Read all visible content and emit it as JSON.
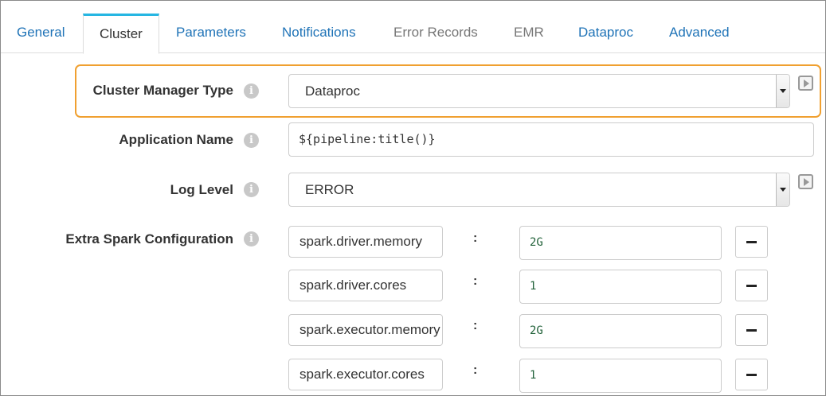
{
  "tabs": [
    {
      "label": "General",
      "state": "link"
    },
    {
      "label": "Cluster",
      "state": "active"
    },
    {
      "label": "Parameters",
      "state": "link"
    },
    {
      "label": "Notifications",
      "state": "link"
    },
    {
      "label": "Error Records",
      "state": "muted"
    },
    {
      "label": "EMR",
      "state": "muted"
    },
    {
      "label": "Dataproc",
      "state": "link"
    },
    {
      "label": "Advanced",
      "state": "link"
    }
  ],
  "fields": {
    "cluster_manager_type": {
      "label": "Cluster Manager Type",
      "value": "Dataproc"
    },
    "application_name": {
      "label": "Application Name",
      "value": "${pipeline:title()}"
    },
    "log_level": {
      "label": "Log Level",
      "value": "ERROR"
    },
    "extra_spark_configuration": {
      "label": "Extra Spark Configuration",
      "separator": ":",
      "entries": [
        {
          "key": "spark.driver.memory",
          "value": "2G"
        },
        {
          "key": "spark.driver.cores",
          "value": "1"
        },
        {
          "key": "spark.executor.memory",
          "value": "2G"
        },
        {
          "key": "spark.executor.cores",
          "value": "1"
        }
      ]
    }
  },
  "icons": {
    "info": "info-icon",
    "play": "play-icon",
    "remove": "minus-icon",
    "dropdown": "chevron-down-icon"
  },
  "colors": {
    "link": "#1f73b7",
    "muted_tab": "#777777",
    "active_tab_accent": "#26b6e2",
    "highlight_border": "#f0a030",
    "value_text": "#22623a"
  }
}
